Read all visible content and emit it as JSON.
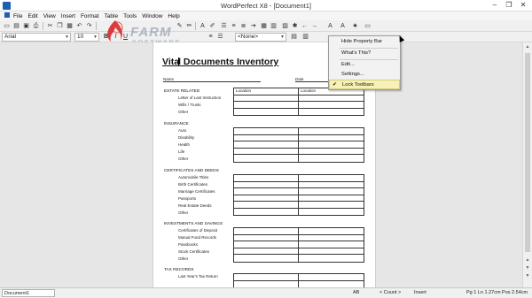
{
  "window": {
    "title": "WordPerfect X8 - [Document1]",
    "controls": {
      "minimize": "–",
      "restore": "❐",
      "close": "✕"
    }
  },
  "menubar": {
    "items": [
      "File",
      "Edit",
      "View",
      "Insert",
      "Format",
      "Table",
      "Tools",
      "Window",
      "Help"
    ]
  },
  "property_bar": {
    "font": "Arial",
    "size": "10",
    "style": "<None>"
  },
  "toolbar_glyphs": {
    "bold": "B",
    "italic": "I",
    "underline": "U",
    "back": "←",
    "forward": "→"
  },
  "watermark": {
    "name": "FARM",
    "sub": "SOFTWARE"
  },
  "document": {
    "title_before_cursor": "Vita",
    "title_after_cursor": "l Documents Inventory",
    "name_label": "Name",
    "date_label": "Date",
    "column_location": "Location",
    "sections": [
      {
        "title": "ESTATE RELATED",
        "items": [
          "Letter of Last Instruction",
          "Wills / Trusts",
          "Other"
        ]
      },
      {
        "title": "INSURANCE",
        "items": [
          "Auto",
          "Disability",
          "Health",
          "Life",
          "Other"
        ]
      },
      {
        "title": "CERTIFICATES AND DEEDS",
        "items": [
          "Automobile Titles",
          "Birth Certificates",
          "Marriage Certificates",
          "Passports",
          "Real Estate Deeds",
          "Other"
        ]
      },
      {
        "title": "INVESTMENTS AND SAVINGS",
        "items": [
          "Certificates of Deposit",
          "Mutual Fund Records",
          "Passbooks",
          "Stock Certificates",
          "Other"
        ]
      },
      {
        "title": "TAX RECORDS",
        "items": [
          "Last Year's Tax Return"
        ]
      }
    ]
  },
  "context_menu": {
    "items": [
      {
        "label": "Hide Property Bar",
        "checked": false
      },
      {
        "label": "What's This?",
        "checked": false
      },
      {
        "label": "Edit...",
        "checked": false
      },
      {
        "label": "Settings...",
        "checked": false
      },
      {
        "label": "Lock Toolbars",
        "checked": true
      }
    ],
    "check_glyph": "✔"
  },
  "statusbar": {
    "doc_tab": "Document1",
    "view_mode": "AB",
    "count": "< Count >",
    "mode": "Insert",
    "position": "Pg 1 Ln 1.27cm Pos 2.54cm"
  },
  "colors": {
    "accent": "#1f5fb0",
    "menu_highlight": "#f6f1b6"
  }
}
